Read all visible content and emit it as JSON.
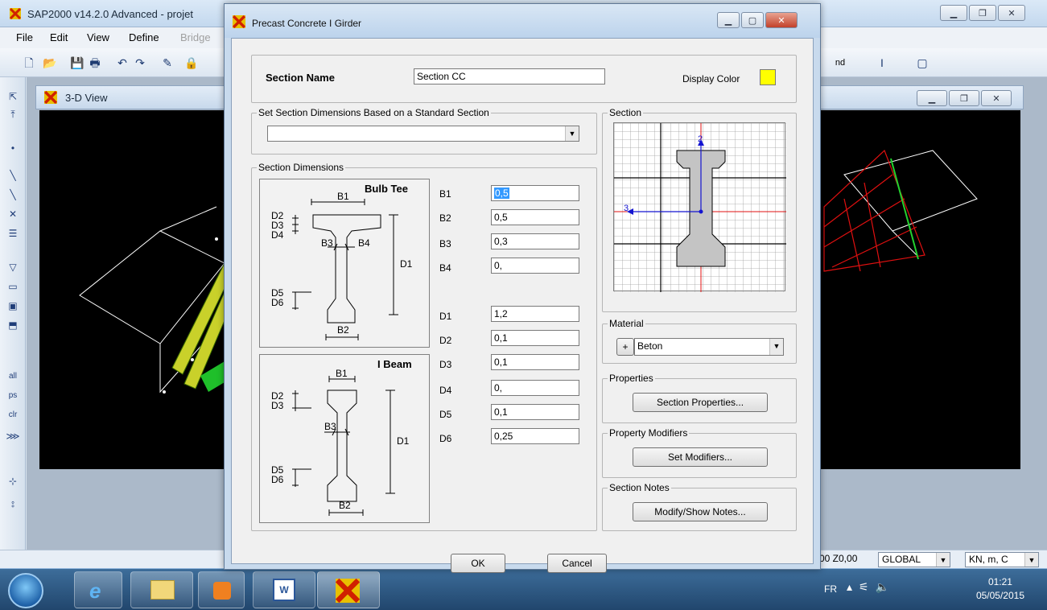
{
  "app": {
    "title": "SAP2000 v14.2.0 Advanced  - projet",
    "menu": [
      "File",
      "Edit",
      "View",
      "Define",
      "Bridge"
    ],
    "view_title": "3-D View",
    "toolbar_right_text": "nd",
    "left_tool_labels": [
      "all",
      "ps",
      "clr"
    ]
  },
  "statusbar": {
    "coord_text": "00  Z0,00",
    "coord_system": "GLOBAL",
    "units": "KN, m, C"
  },
  "dialog": {
    "title": "Precast Concrete I Girder",
    "section_name_label": "Section Name",
    "section_name_value": "Section CC",
    "display_color_label": "Display Color",
    "display_color": "#ffff00",
    "standard_group_label": "Set Section Dimensions Based on a Standard Section",
    "standard_value": "",
    "dims_group_label": "Section Dimensions",
    "bulb_tee": {
      "title": "Bulb Tee",
      "labels": [
        "B1",
        "D2",
        "D3",
        "D4",
        "B3",
        "B4",
        "D1",
        "D5",
        "D6",
        "B2"
      ]
    },
    "i_beam": {
      "title": "I Beam",
      "labels": [
        "B1",
        "D2",
        "D3",
        "B3",
        "D1",
        "D5",
        "D6",
        "B2"
      ]
    },
    "dims": [
      {
        "label": "B1",
        "value": "0,5",
        "selected": true
      },
      {
        "label": "B2",
        "value": "0,5"
      },
      {
        "label": "B3",
        "value": "0,3"
      },
      {
        "label": "B4",
        "value": "0,"
      },
      {
        "label": "D1",
        "value": "1,2"
      },
      {
        "label": "D2",
        "value": "0,1"
      },
      {
        "label": "D3",
        "value": "0,1"
      },
      {
        "label": "D4",
        "value": "0,"
      },
      {
        "label": "D5",
        "value": "0,1"
      },
      {
        "label": "D6",
        "value": "0,25"
      }
    ],
    "section_group_label": "Section",
    "preview_axes": {
      "vertical": "2",
      "horizontal": "3"
    },
    "material_group_label": "Material",
    "material_plus": "+",
    "material_value": "Beton",
    "properties_group_label": "Properties",
    "properties_button": "Section Properties...",
    "modifiers_group_label": "Property Modifiers",
    "modifiers_button": "Set Modifiers...",
    "notes_group_label": "Section Notes",
    "notes_button": "Modify/Show Notes...",
    "ok_button": "OK",
    "cancel_button": "Cancel"
  },
  "taskbar": {
    "lang": "FR",
    "time": "01:21",
    "date": "05/05/2015"
  }
}
